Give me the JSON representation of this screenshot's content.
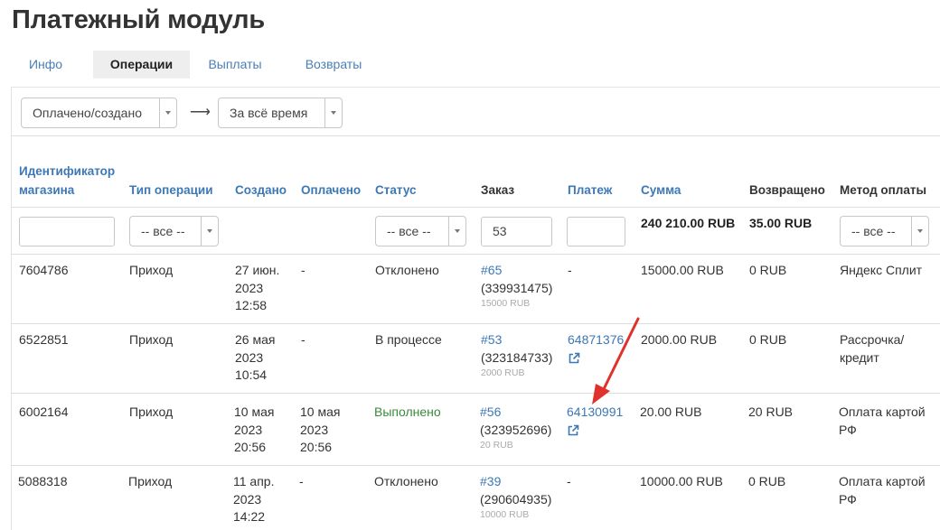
{
  "title": "Платежный модуль",
  "tabs": [
    {
      "label": "Инфо"
    },
    {
      "label": "Операции"
    },
    {
      "label": "Выплаты"
    },
    {
      "label": "Возвраты"
    }
  ],
  "filters": {
    "status_select": "Оплачено/создано",
    "period_select": "За всё время"
  },
  "columns": [
    "Идентификатор магазина",
    "Тип операции",
    "Создано",
    "Оплачено",
    "Статус",
    "Заказ",
    "Платеж",
    "Сумма",
    "Возвращено",
    "Метод оплаты"
  ],
  "column_filters": {
    "type_select": "-- все --",
    "status_select": "-- все --",
    "order_value": "53",
    "method_select": "-- все --",
    "total_sum": "240 210.00 RUB",
    "total_refunded": "35.00 RUB"
  },
  "rows": [
    {
      "shop_id": "7604786",
      "type": "Приход",
      "created": [
        "27 июн.",
        "2023",
        "12:58"
      ],
      "paid": [
        "-"
      ],
      "status": "Отклонено",
      "order": "#65",
      "order_id": "(339931475)",
      "order_sum": "15000 RUB",
      "payment": "-",
      "amount": "15000.00 RUB",
      "refunded": "0 RUB",
      "method": [
        "Яндекс Сплит"
      ]
    },
    {
      "shop_id": "6522851",
      "type": "Приход",
      "created": [
        "26 мая",
        "2023",
        "10:54"
      ],
      "paid": [
        "-"
      ],
      "status": "В процессе",
      "order": "#53",
      "order_id": "(323184733)",
      "order_sum": "2000 RUB",
      "payment": "64871376",
      "amount": "2000.00 RUB",
      "refunded": "0 RUB",
      "method": [
        "Рассрочка/",
        "кредит"
      ]
    },
    {
      "shop_id": "6002164",
      "type": "Приход",
      "created": [
        "10 мая",
        "2023",
        "20:56"
      ],
      "paid": [
        "10 мая",
        "2023",
        "20:56"
      ],
      "status": "Выполнено",
      "order": "#56",
      "order_id": "(323952696)",
      "order_sum": "20 RUB",
      "payment": "64130991",
      "amount": "20.00 RUB",
      "refunded": "20 RUB",
      "method": [
        "Оплата картой",
        "РФ"
      ]
    },
    {
      "shop_id": "5088318",
      "type": "Приход",
      "created": [
        "11 апр.",
        "2023",
        "14:22"
      ],
      "paid": [
        "-"
      ],
      "status": "Отклонено",
      "order": "#39",
      "order_id": "(290604935)",
      "order_sum": "10000 RUB",
      "payment": "-",
      "amount": "10000.00 RUB",
      "refunded": "0 RUB",
      "method": [
        "Оплата картой",
        "РФ"
      ]
    }
  ],
  "colors": {
    "link": "#3d78b5",
    "success": "#3b8a3b",
    "annotation_arrow": "#e0322c",
    "active_tab_bg": "#eeeeee"
  },
  "icons": [
    "external-link-icon",
    "dropdown-caret-icon",
    "right-arrow-icon",
    "annotation-arrow"
  ]
}
